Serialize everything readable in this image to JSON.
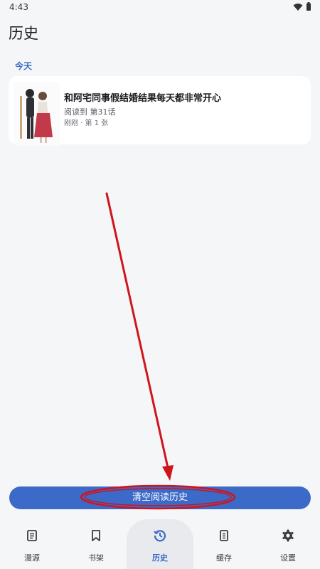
{
  "status_bar": {
    "time": "4:43",
    "wifi_icon": "wifi-icon",
    "battery_icon": "battery-icon"
  },
  "header": {
    "title": "历史"
  },
  "history": {
    "section_label": "今天",
    "items": [
      {
        "title": "和阿宅同事假结婚结果每天都非常开心",
        "progress": "阅读到 第31话",
        "time": "刚刚 · 第 1 张"
      }
    ]
  },
  "clear_button": {
    "label": "清空阅读历史"
  },
  "bottom_nav": {
    "items": [
      {
        "label": "漫源",
        "icon": "document-icon"
      },
      {
        "label": "书架",
        "icon": "bookmark-icon"
      },
      {
        "label": "历史",
        "icon": "history-icon",
        "active": true
      },
      {
        "label": "缓存",
        "icon": "file-icon"
      },
      {
        "label": "设置",
        "icon": "gear-icon"
      }
    ]
  },
  "colors": {
    "accent": "#3b6ac9",
    "annotation": "#d0141b",
    "background": "#f5f6f8"
  }
}
